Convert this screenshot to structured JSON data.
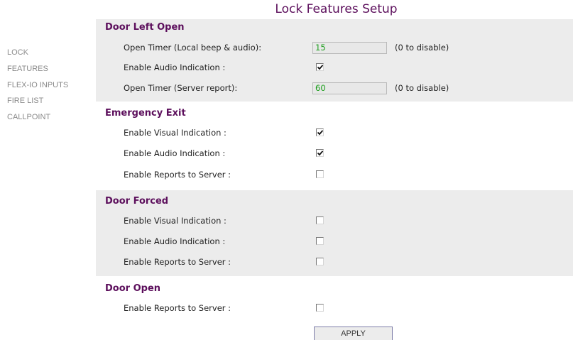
{
  "page": {
    "title": "Lock Features Setup"
  },
  "nav": {
    "items": [
      {
        "label": "LOCK"
      },
      {
        "label": "FEATURES"
      },
      {
        "label": "FLEX-IO INPUTS"
      },
      {
        "label": "FIRE LIST"
      },
      {
        "label": "CALLPOINT"
      }
    ]
  },
  "sections": {
    "door_left_open": {
      "title": "Door Left Open",
      "open_timer_local_label": "Open Timer (Local beep & audio):",
      "open_timer_local_value": "15",
      "open_timer_local_hint": "(0 to disable)",
      "audio_label": "Enable Audio Indication :",
      "audio_checked": true,
      "open_timer_server_label": "Open Timer (Server report):",
      "open_timer_server_value": "60",
      "open_timer_server_hint": "(0 to disable)"
    },
    "emergency_exit": {
      "title": "Emergency Exit",
      "visual_label": "Enable Visual Indication :",
      "visual_checked": true,
      "audio_label": "Enable Audio Indication :",
      "audio_checked": true,
      "reports_label": "Enable Reports to Server :",
      "reports_checked": false
    },
    "door_forced": {
      "title": "Door Forced",
      "visual_label": "Enable Visual Indication :",
      "visual_checked": false,
      "audio_label": "Enable Audio Indication :",
      "audio_checked": false,
      "reports_label": "Enable Reports to Server :",
      "reports_checked": false
    },
    "door_open": {
      "title": "Door Open",
      "reports_label": "Enable Reports to Server :",
      "reports_checked": false
    }
  },
  "actions": {
    "apply_label": "APPLY"
  },
  "colors": {
    "accent": "#5c0f5c",
    "section_background": "#ececec",
    "field_value": "#1e9e1e",
    "nav_text": "#8a8a8a"
  }
}
